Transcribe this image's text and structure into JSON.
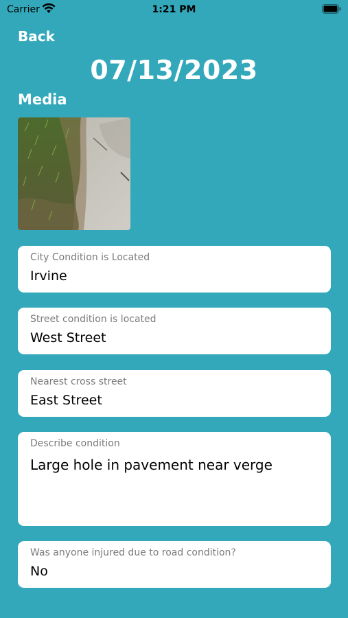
{
  "status_bar": {
    "carrier": "Carrier",
    "time": "1:21 PM"
  },
  "nav": {
    "back_label": "Back"
  },
  "report": {
    "date": "07/13/2023",
    "media_heading": "Media"
  },
  "fields": [
    {
      "label": "City Condition is Located",
      "value": "Irvine"
    },
    {
      "label": "Street condition is located",
      "value": "West Street"
    },
    {
      "label": "Nearest cross street",
      "value": "East Street"
    },
    {
      "label": "Describe condition",
      "value": "Large hole in pavement near verge"
    },
    {
      "label": "Was anyone injured due to road condition?",
      "value": "No"
    }
  ],
  "colors": {
    "background": "#33A8BA",
    "card": "#FFFFFF",
    "label": "#7A7A7A"
  }
}
